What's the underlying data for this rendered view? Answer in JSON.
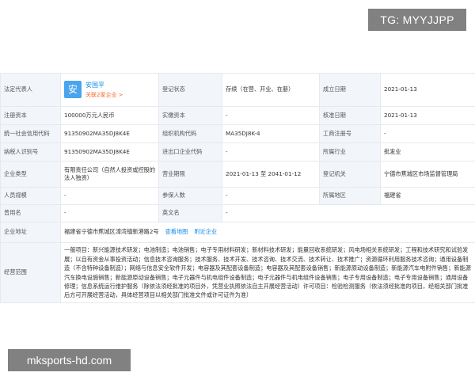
{
  "watermarks": {
    "top": "TG: MYYJJPP",
    "bottom": "mksports-hd.com"
  },
  "representative": {
    "label": "法定代表人",
    "avatar_char": "安",
    "name": "安国平",
    "related": "关联2家企业 >"
  },
  "reg_status": {
    "label": "登记状态",
    "value": "存续（在营、开业、在册）"
  },
  "established": {
    "label": "成立日期",
    "value": "2021-01-13"
  },
  "reg_capital": {
    "label": "注册资本",
    "value": "100000万元人民币"
  },
  "paid_capital": {
    "label": "实缴资本",
    "value": "-"
  },
  "approval_date": {
    "label": "核准日期",
    "value": "2021-01-13"
  },
  "credit_code": {
    "label": "统一社会信用代码",
    "value": "91350902MA35DJ8K4E"
  },
  "org_code": {
    "label": "组织机构代码",
    "value": "MA35DJ8K-4"
  },
  "biz_reg_no": {
    "label": "工商注册号",
    "value": "-"
  },
  "taxpayer_id": {
    "label": "纳税人识别号",
    "value": "91350902MA35DJ8K4E"
  },
  "import_export": {
    "label": "进出口企业代码",
    "value": "-"
  },
  "industry": {
    "label": "所属行业",
    "value": "批发业"
  },
  "company_type": {
    "label": "企业类型",
    "value": "有限责任公司（自然人投资或控股的法人独资）"
  },
  "biz_term": {
    "label": "营业期限",
    "value": "2021-01-13 至 2041-01-12"
  },
  "reg_authority": {
    "label": "登记机关",
    "value": "宁德市蕉城区市场监督管理局"
  },
  "staff_size": {
    "label": "人员规模",
    "value": "-"
  },
  "insured": {
    "label": "参保人数",
    "value": "-"
  },
  "region": {
    "label": "所属地区",
    "value": "福建省"
  },
  "former_name": {
    "label": "曾用名",
    "value": "-"
  },
  "english_name": {
    "label": "英文名",
    "value": "-"
  },
  "address": {
    "label": "企业地址",
    "value": "福建省宁德市蕉城区漳湾镇新港路2号",
    "map_link": "查看地图",
    "nearby_link": "附近企业"
  },
  "scope": {
    "label": "经营范围",
    "value": "一般项目：新兴能源技术研发；电池制造；电池销售；电子专用材料研发；新材料技术研发；能量回收系统研发；风电场相关系统研发；工程和技术研究和试验发展；以自有资金从事投资活动；信息技术咨询服务；技术服务、技术开发、技术咨询、技术交流、技术转让、技术推广；资源循环利用服务技术咨询；通用设备制造（不含特种设备制造）；网络与信息安全软件开发；电容器及其配套设备制造；电容器及其配套设备销售；新能源原动设备制造；新能源汽车电附件销售；新能源汽车换电设施销售；新能源原动设备销售；电子元器件与机电组件设备制造；电子元器件与机电组件设备销售；电子专用设备制造；电子专用设备销售；通用设备修理；信息系统运行维护服务（除依法须经批准的项目外，凭营业执照依法自主开展经营活动）许可项目：检验检测服务（依法须经批准的项目，经相关部门批准后方可开展经营活动，具体经营项目以相关部门批准文件或许可证件为准）"
  }
}
